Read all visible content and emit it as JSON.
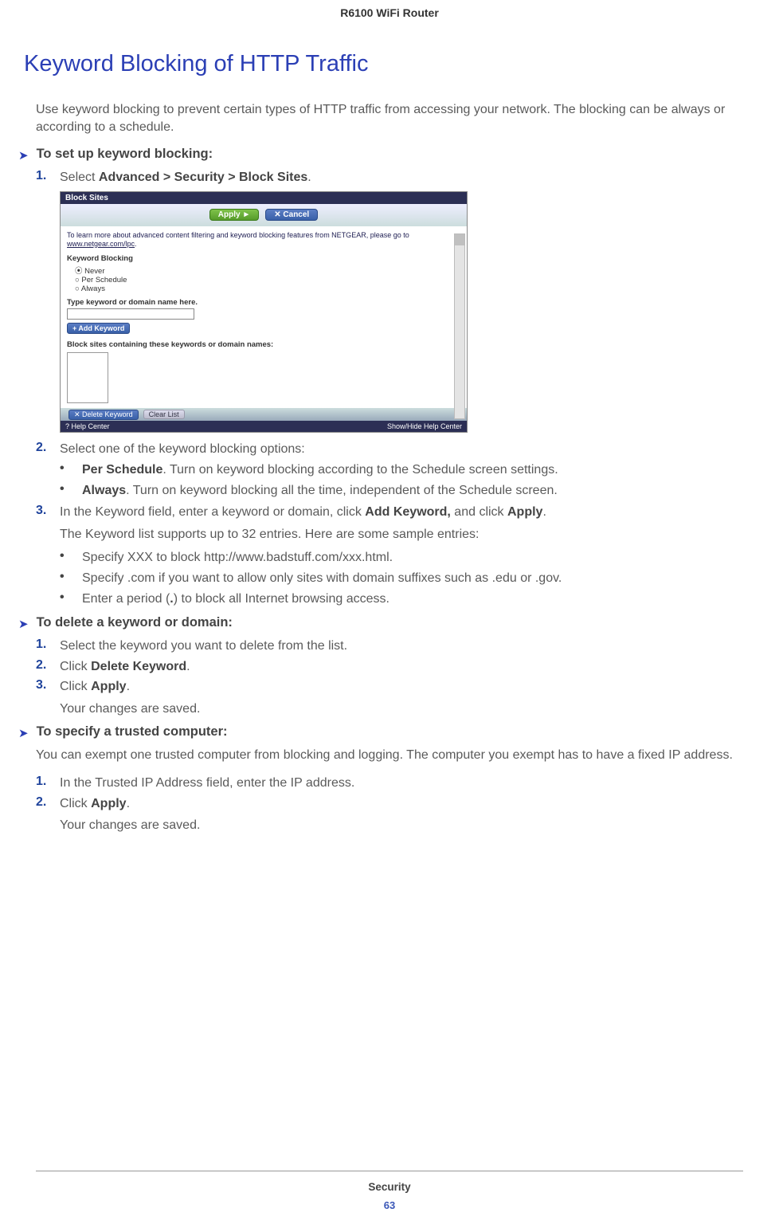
{
  "header": {
    "product": "R6100 WiFi Router"
  },
  "title": "Keyword Blocking of HTTP Traffic",
  "intro": "Use keyword blocking to prevent certain types of HTTP traffic from accessing your network. The blocking can be always or according to a schedule.",
  "proc1": {
    "heading": "To set up keyword blocking:",
    "step1_pre": "Select ",
    "step1_path": "Advanced > Security > Block Sites",
    "step1_post": ".",
    "screenshot": {
      "titlebar": "Block Sites",
      "apply": "Apply ►",
      "cancel": "✕ Cancel",
      "info_line1": "To learn more about advanced content filtering and keyword blocking features from NETGEAR, please go to",
      "info_link": "www.netgear.com/lpc",
      "kb_label": "Keyword Blocking",
      "radio1": "Never",
      "radio2": "Per Schedule",
      "radio3": "Always",
      "type_label": "Type keyword or domain name here.",
      "add_kw": "+ Add Keyword",
      "block_label": "Block sites containing these keywords or domain names:",
      "del_kw": "✕ Delete Keyword",
      "clear": "Clear List",
      "help_left": "? Help Center",
      "help_right": "Show/Hide Help Center"
    },
    "step2": "Select one of the keyword blocking options:",
    "b1_label": "Per Schedule",
    "b1_text": ". Turn on keyword blocking according to the Schedule screen settings.",
    "b2_label": "Always",
    "b2_text": ". Turn on keyword blocking all the time, independent of the Schedule screen.",
    "step3_pre": "In the Keyword field, enter a keyword or domain, click ",
    "step3_addkw": "Add Keyword,",
    "step3_mid": " and click ",
    "step3_apply": "Apply",
    "step3_post": ".",
    "step3_sub": "The Keyword list supports up to 32 entries. Here are some sample entries:",
    "s1": "Specify XXX to block http://www.badstuff.com/xxx.html.",
    "s2": "Specify .com if you want to allow only sites with domain suffixes such as .edu or .gov.",
    "s3_pre": "Enter a period (",
    "s3_dot": ".",
    "s3_post": ") to block all Internet browsing access."
  },
  "proc2": {
    "heading": "To delete a keyword or domain:",
    "step1": "Select the keyword you want to delete from the list.",
    "step2_pre": "Click ",
    "step2_b": "Delete Keyword",
    "step2_post": ".",
    "step3_pre": "Click ",
    "step3_b": "Apply",
    "step3_post": ".",
    "step3_sub": "Your changes are saved."
  },
  "proc3": {
    "heading": "To specify a trusted computer:",
    "intro": "You can exempt one trusted computer from blocking and logging. The computer you exempt has to have a fixed IP address.",
    "step1": "In the Trusted IP Address field, enter the IP address.",
    "step2_pre": "Click ",
    "step2_b": "Apply",
    "step2_post": ".",
    "step2_sub": "Your changes are saved."
  },
  "footer": {
    "section": "Security",
    "page": "63"
  }
}
